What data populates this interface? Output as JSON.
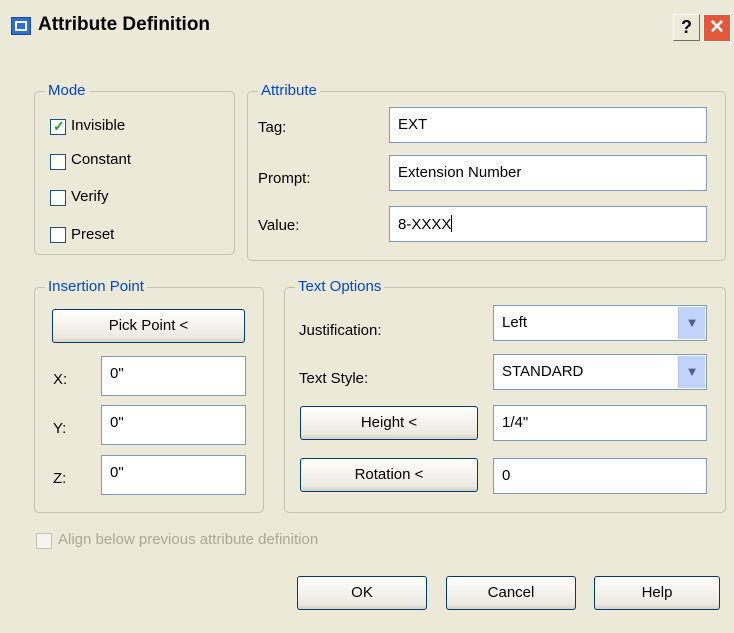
{
  "window": {
    "title": "Attribute Definition",
    "help_glyph": "?",
    "close_glyph": "✕"
  },
  "mode": {
    "legend": "Mode",
    "items": [
      {
        "label": "Invisible",
        "checked": true
      },
      {
        "label": "Constant",
        "checked": false
      },
      {
        "label": "Verify",
        "checked": false
      },
      {
        "label": "Preset",
        "checked": false
      }
    ]
  },
  "attribute": {
    "legend": "Attribute",
    "tag_label": "Tag:",
    "tag_value": "EXT",
    "prompt_label": "Prompt:",
    "prompt_value": "Extension Number",
    "value_label": "Value:",
    "value_value": "8-XXXX"
  },
  "insertion": {
    "legend": "Insertion Point",
    "pick_button": "Pick Point <",
    "x_label": "X:",
    "x_value": "0\"",
    "y_label": "Y:",
    "y_value": "0\"",
    "z_label": "Z:",
    "z_value": "0\""
  },
  "text_options": {
    "legend": "Text Options",
    "justification_label": "Justification:",
    "justification_value": "Left",
    "style_label": "Text Style:",
    "style_value": "STANDARD",
    "height_button": "Height <",
    "height_value": "1/4\"",
    "rotation_button": "Rotation <",
    "rotation_value": "0"
  },
  "align": {
    "label": "Align below previous attribute definition",
    "checked": false,
    "enabled": false
  },
  "buttons": {
    "ok": "OK",
    "cancel": "Cancel",
    "help": "Help"
  }
}
